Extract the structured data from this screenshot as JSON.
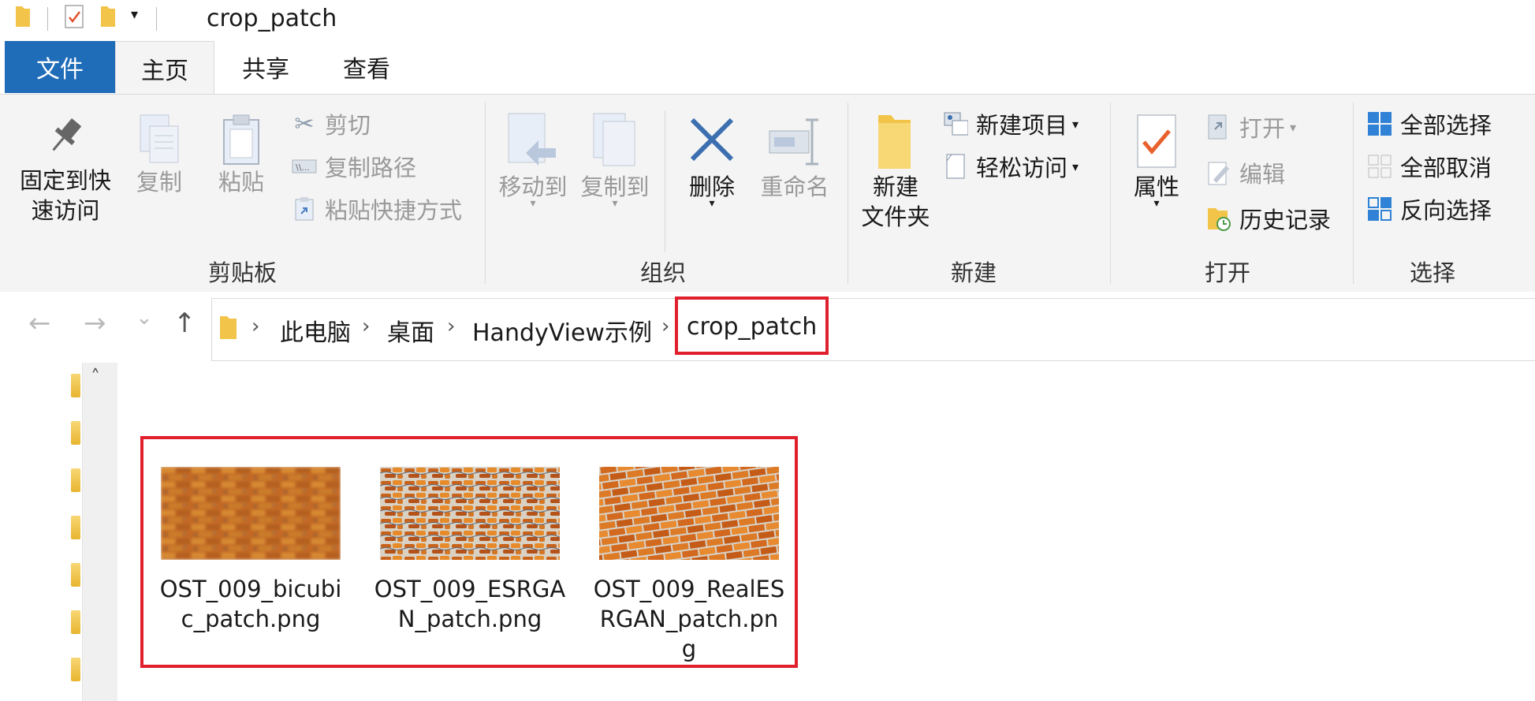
{
  "window": {
    "title": "crop_patch"
  },
  "tabs": [
    {
      "label": "文件"
    },
    {
      "label": "主页"
    },
    {
      "label": "共享"
    },
    {
      "label": "查看"
    }
  ],
  "ribbon": {
    "clipboard": {
      "group_label": "剪贴板",
      "pin_label_1": "固定到快",
      "pin_label_2": "速访问",
      "copy_label": "复制",
      "paste_label": "粘贴",
      "cut_label": "剪切",
      "copy_path_label": "复制路径",
      "paste_shortcut_label": "粘贴快捷方式"
    },
    "organize": {
      "group_label": "组织",
      "move_to_label": "移动到",
      "copy_to_label": "复制到",
      "delete_label": "删除",
      "rename_label": "重命名"
    },
    "new": {
      "group_label": "新建",
      "new_folder_label_1": "新建",
      "new_folder_label_2": "文件夹",
      "new_item_label": "新建项目",
      "easy_access_label": "轻松访问"
    },
    "open": {
      "group_label": "打开",
      "properties_label": "属性",
      "open_label": "打开",
      "edit_label": "编辑",
      "history_label": "历史记录"
    },
    "select": {
      "group_label": "选择",
      "select_all_label": "全部选择",
      "select_none_label": "全部取消",
      "invert_selection_label": "反向选择"
    }
  },
  "nav": {
    "back": "←",
    "forward": "→",
    "recent": "⌄",
    "up": "↑"
  },
  "breadcrumb": [
    "此电脑",
    "桌面",
    "HandyView示例",
    "crop_patch"
  ],
  "files": [
    {
      "name": "OST_009_bicubic_patch.png"
    },
    {
      "name": "OST_009_ESRGAN_patch.png"
    },
    {
      "name": "OST_009_RealESRGAN_patch.png"
    }
  ],
  "colors": {
    "accent": "#1f6cb8",
    "highlight": "#e0202c",
    "folder": "#f0c040"
  }
}
